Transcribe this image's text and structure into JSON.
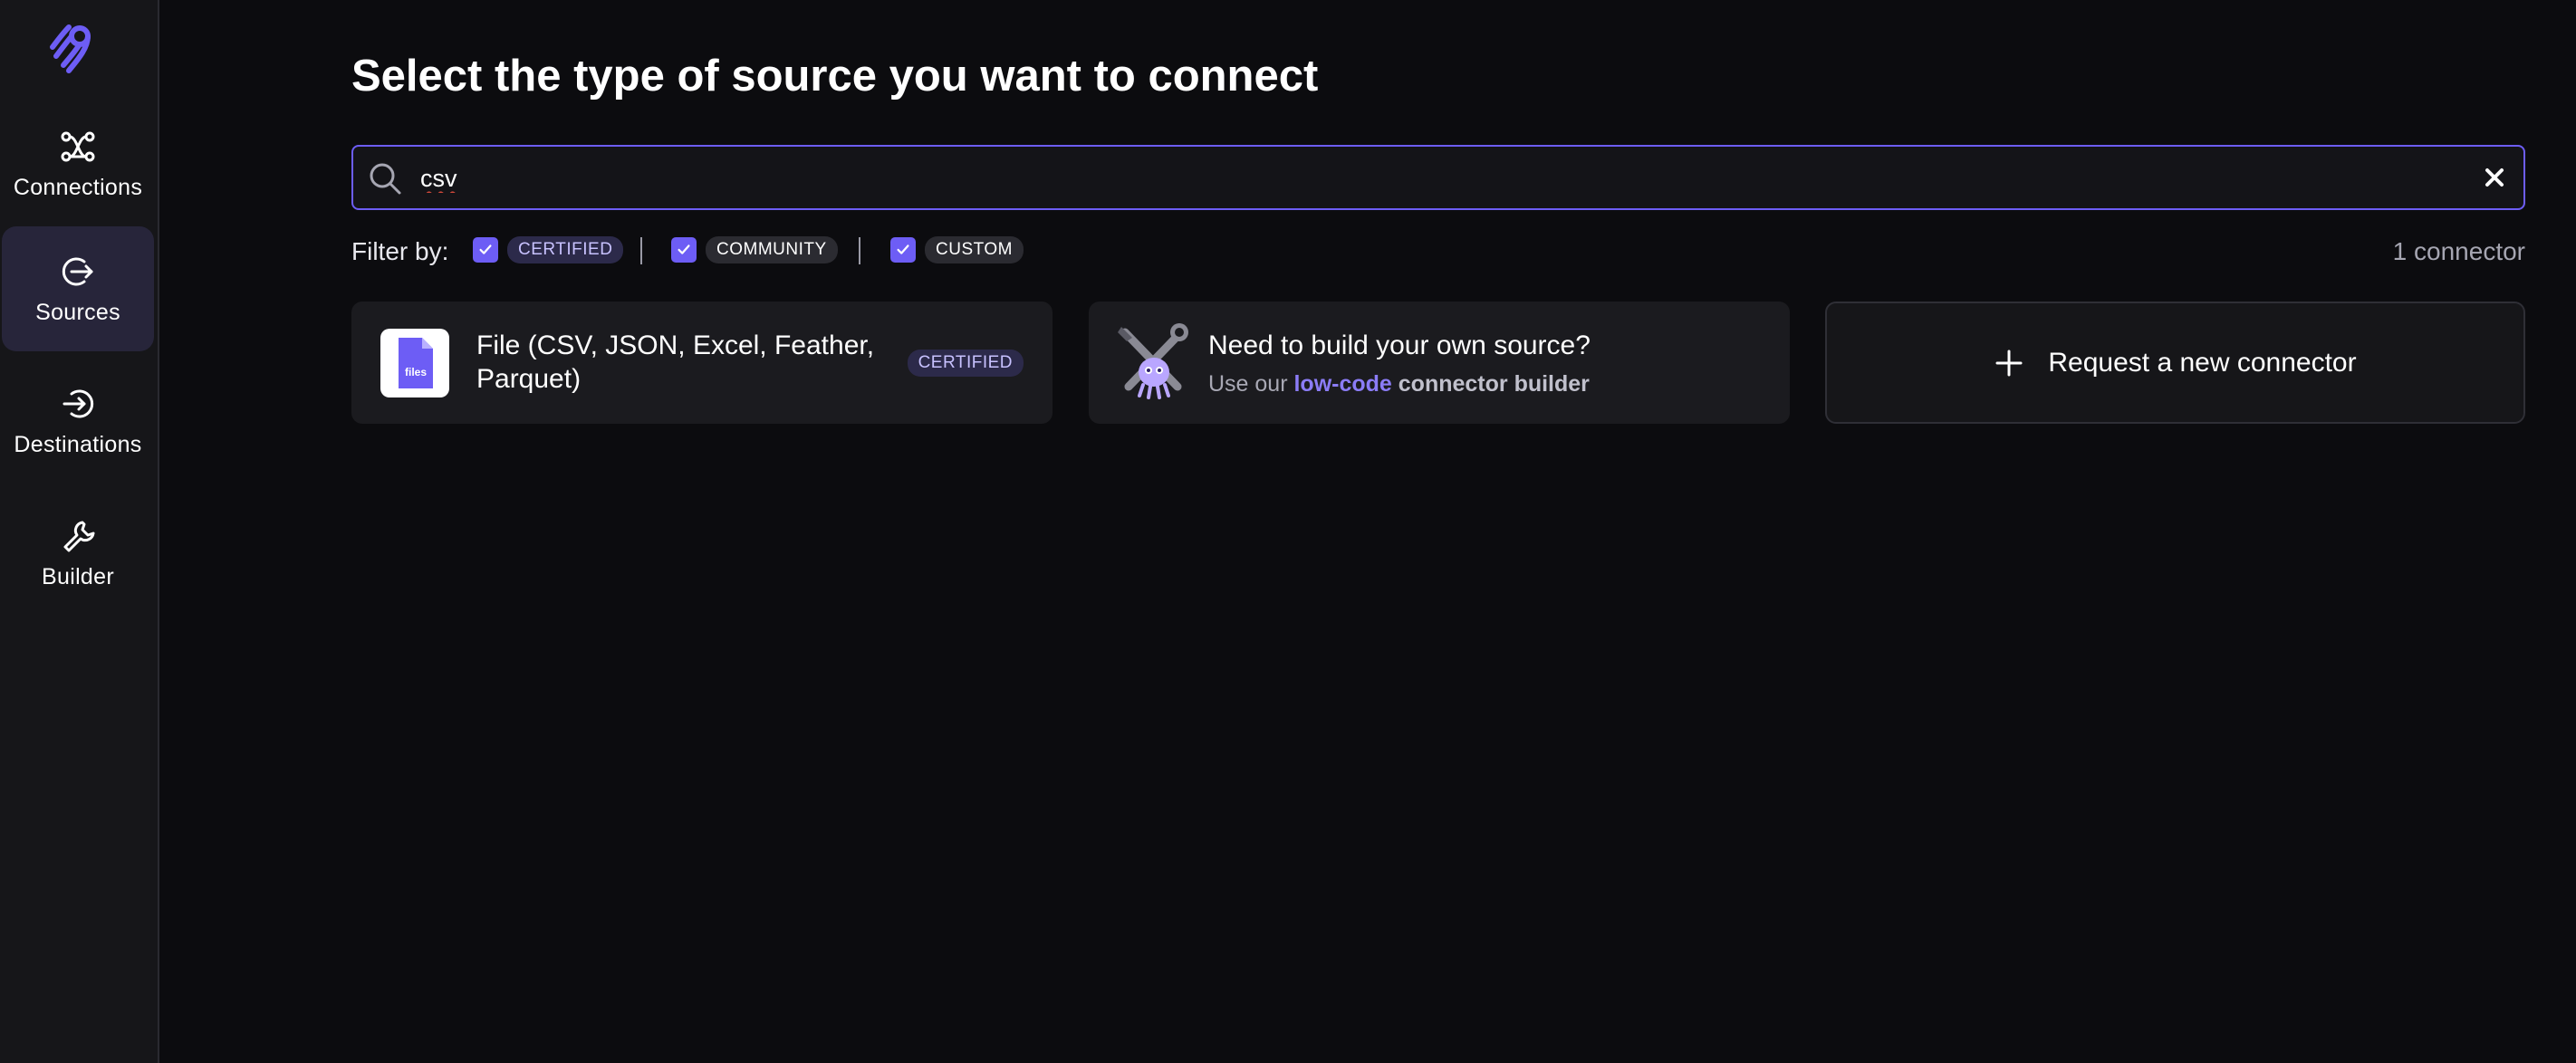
{
  "sidebar": {
    "items": [
      {
        "label": "Connections",
        "icon": "connections-icon",
        "active": false
      },
      {
        "label": "Sources",
        "icon": "sources-icon",
        "active": true
      },
      {
        "label": "Destinations",
        "icon": "destinations-icon",
        "active": false
      },
      {
        "label": "Builder",
        "icon": "builder-icon",
        "active": false
      }
    ]
  },
  "page": {
    "title": "Select the type of source you want to connect"
  },
  "search": {
    "value": "csv",
    "placeholder": ""
  },
  "filters": {
    "label": "Filter by:",
    "options": [
      {
        "label": "CERTIFIED",
        "checked": true
      },
      {
        "label": "COMMUNITY",
        "checked": true
      },
      {
        "label": "CUSTOM",
        "checked": true
      }
    ],
    "count": "1 connector"
  },
  "results": [
    {
      "name": "File (CSV, JSON, Excel, Feather, Parquet)",
      "badge": "CERTIFIED",
      "icon_text": "files"
    }
  ],
  "builder_card": {
    "title": "Need to build your own source?",
    "sub_prefix": "Use our ",
    "sub_highlight": "low-code",
    "sub_suffix": " connector builder"
  },
  "request_card": {
    "label": "Request a new connector"
  },
  "colors": {
    "accent": "#6d5df5",
    "background": "#0c0c0f",
    "sidebar": "#161619",
    "card": "#1b1b1f"
  }
}
